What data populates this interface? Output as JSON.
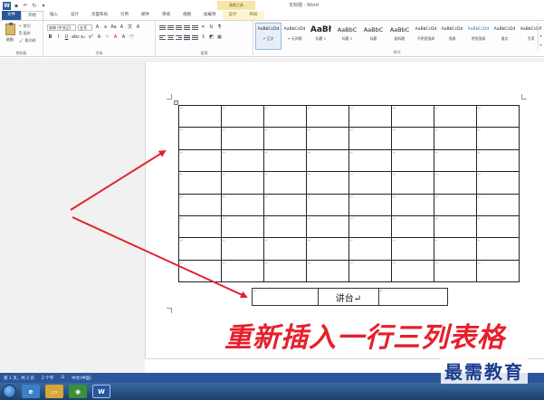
{
  "window": {
    "doc_title": "无标题 - Word",
    "context_tab_title": "表格工具"
  },
  "tabs": [
    "文件",
    "开始",
    "插入",
    "设计",
    "页面布局",
    "引用",
    "邮件",
    "审阅",
    "视图",
    "加载项",
    "设计",
    "布局"
  ],
  "ribbon": {
    "paste_label": "粘贴",
    "cut_label": "剪切",
    "copy_label": "复制",
    "format_painter_label": "格式刷",
    "clipboard_group": "剪贴板",
    "font_name": "宋体 (中文正)",
    "font_size": "五号",
    "font_group": "字体",
    "paragraph_group": "段落",
    "styles_group": "样式",
    "styles": [
      {
        "preview": "AaBbCcDd",
        "name": "↵ 正文"
      },
      {
        "preview": "AaBbCcDd",
        "name": "↵ 无间隔"
      },
      {
        "preview": "AaBł",
        "name": "标题 1"
      },
      {
        "preview": "AaBbC",
        "name": "标题 2"
      },
      {
        "preview": "AaBbC",
        "name": "标题"
      },
      {
        "preview": "AaBbC",
        "name": "副标题"
      },
      {
        "preview": "AaBbCcDd",
        "name": "不明显强调"
      },
      {
        "preview": "AaBbCcDd",
        "name": "强调"
      },
      {
        "preview": "AaBbCcDd",
        "name": "明显强调"
      },
      {
        "preview": "AaBbCcDd",
        "name": "要点"
      },
      {
        "preview": "AaBbCcDc",
        "name": "引用"
      }
    ]
  },
  "table": {
    "rows": 8,
    "cols": 8,
    "cell_mark": "↵"
  },
  "small_table": {
    "cells": [
      "↵",
      "讲台↵",
      "↵"
    ]
  },
  "caption": "重新插入一行三列表格",
  "statusbar": {
    "page": "第 1 页，共 2 页",
    "words": "2 个字",
    "language": "中文(中国)"
  },
  "brand": "最需教育",
  "colors": {
    "accent": "#2b579a",
    "caption": "#e5202c",
    "arrow": "#e5202c"
  }
}
